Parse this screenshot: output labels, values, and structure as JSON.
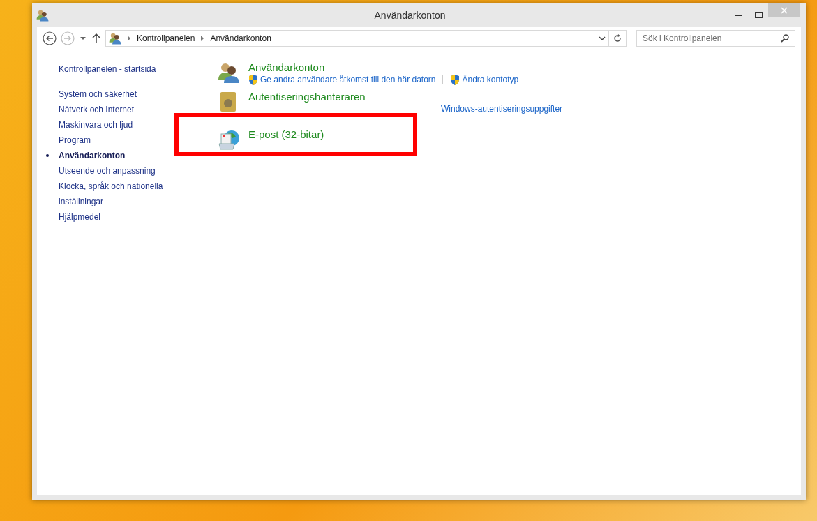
{
  "window": {
    "title": "Användarkonton"
  },
  "address": {
    "breadcrumbs": [
      "Kontrollpanelen",
      "Användarkonton"
    ]
  },
  "search": {
    "placeholder": "Sök i Kontrollpanelen"
  },
  "sidebar": {
    "home": "Kontrollpanelen - startsida",
    "items": [
      {
        "label": "System och säkerhet",
        "selected": false
      },
      {
        "label": "Nätverk och Internet",
        "selected": false
      },
      {
        "label": "Maskinvara och ljud",
        "selected": false
      },
      {
        "label": "Program",
        "selected": false
      },
      {
        "label": "Användarkonton",
        "selected": true
      },
      {
        "label": "Utseende och anpassning",
        "selected": false
      },
      {
        "label": "Klocka, språk och nationella inställningar",
        "selected": false
      },
      {
        "label": "Hjälpmedel",
        "selected": false
      }
    ]
  },
  "categories": [
    {
      "kind": "users",
      "title": "Användarkonton",
      "links": [
        {
          "text": "Ge andra användare åtkomst till den här datorn",
          "shield": true
        },
        {
          "text": "Ändra kontotyp",
          "shield": true
        }
      ]
    },
    {
      "kind": "vault",
      "title": "Autentiseringshanteraren",
      "links": [
        {
          "text": "Windows-autentiseringsuppgifter",
          "shield": false
        }
      ]
    },
    {
      "kind": "mail",
      "title": "E-post (32-bitar)"
    }
  ]
}
